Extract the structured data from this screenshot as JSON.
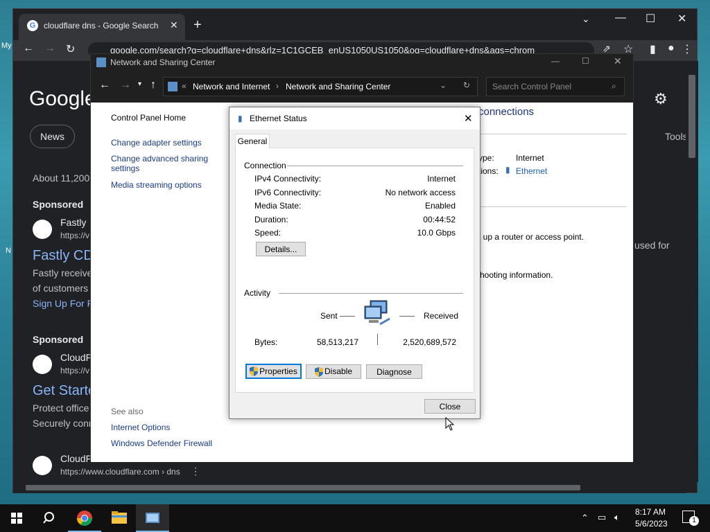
{
  "desktop": {
    "labels": [
      "My",
      "N"
    ]
  },
  "chrome": {
    "tab_title": "cloudflare dns - Google Search",
    "url": "google.com/search?q=cloudflare+dns&rlz=1C1GCEB_enUS1050US1050&oq=cloudflare+dns&aqs=chrom",
    "page": {
      "logo": "Google",
      "chips": [
        "News",
        "Tools"
      ],
      "results_count": "About 11,200,",
      "sponsored_1": "Sponsored",
      "ad1_name": "Fastly",
      "ad1_url": "https://v",
      "ad1_title": "Fastly CD",
      "ad1_desc1": "Fastly receive",
      "ad1_desc2": "of customers",
      "ad1_link": "Sign Up For F",
      "sponsored_2": "Sponsored",
      "ad2_name": "CloudF",
      "ad2_url": "https://v",
      "ad2_title": "Get Starte",
      "ad2_desc1": "Protect office",
      "ad2_desc2": "Securely conn",
      "res3_name": "CloudFla",
      "res3_url": "https://www.cloudflare.com › dns",
      "right_fragment": "used for"
    }
  },
  "control_panel": {
    "title": "Network and Sharing Center",
    "breadcrumb": [
      "Network and Internet",
      "Network and Sharing Center"
    ],
    "search_placeholder": "Search Control Panel",
    "sidebar": {
      "home": "Control Panel Home",
      "links": [
        "Change adapter settings",
        "Change advanced sharing settings",
        "Media streaming options"
      ],
      "see_also": "See also",
      "see_also_links": [
        "Internet Options",
        "Windows Defender Firewall"
      ]
    },
    "main": {
      "heading_fragment": "connections",
      "access_type_label": "ype:",
      "access_type_value": "Internet",
      "connections_label": "tions:",
      "connections_value": "Ethernet",
      "router_text": "t up a router or access point.",
      "troubleshoot_text": "hooting information."
    }
  },
  "dialog": {
    "title": "Ethernet Status",
    "tab": "General",
    "connection_header": "Connection",
    "rows": [
      {
        "label": "IPv4 Connectivity:",
        "value": "Internet"
      },
      {
        "label": "IPv6 Connectivity:",
        "value": "No network access"
      },
      {
        "label": "Media State:",
        "value": "Enabled"
      },
      {
        "label": "Duration:",
        "value": "00:44:52"
      },
      {
        "label": "Speed:",
        "value": "10.0 Gbps"
      }
    ],
    "details_button": "Details...",
    "activity_header": "Activity",
    "sent_label": "Sent",
    "received_label": "Received",
    "bytes_label": "Bytes:",
    "bytes_sent": "58,513,217",
    "bytes_received": "2,520,689,572",
    "properties_button": "Properties",
    "disable_button": "Disable",
    "diagnose_button": "Diagnose",
    "close_button": "Close"
  },
  "taskbar": {
    "time": "8:17 AM",
    "date": "5/6/2023",
    "notification_count": "1"
  }
}
